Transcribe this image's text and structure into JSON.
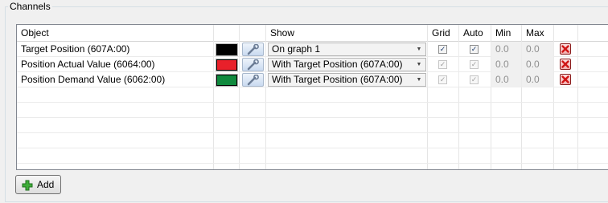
{
  "group": {
    "title": "Channels"
  },
  "table": {
    "columns": [
      "Object",
      "",
      "",
      "Show",
      "Grid",
      "Auto",
      "Min",
      "Max",
      ""
    ],
    "rows": [
      {
        "object": "Target Position (607A:00)",
        "color": "#000000",
        "show": "On graph 1",
        "grid": true,
        "auto": true,
        "checks_enabled": true,
        "min": "0.0",
        "max": "0.0"
      },
      {
        "object": "Position Actual Value (6064:00)",
        "color": "#e8202a",
        "show": "With Target Position (607A:00)",
        "grid": true,
        "auto": true,
        "checks_enabled": false,
        "min": "0.0",
        "max": "0.0"
      },
      {
        "object": "Position Demand Value (6062:00)",
        "color": "#108a3e",
        "show": "With Target Position (607A:00)",
        "grid": true,
        "auto": true,
        "checks_enabled": false,
        "min": "0.0",
        "max": "0.0"
      }
    ]
  },
  "icons": {
    "edit": "wrench-icon",
    "delete": "red-x-icon",
    "dropdown": "chevron-down-icon",
    "add": "green-plus-icon"
  },
  "add_button": {
    "label": "Add"
  }
}
